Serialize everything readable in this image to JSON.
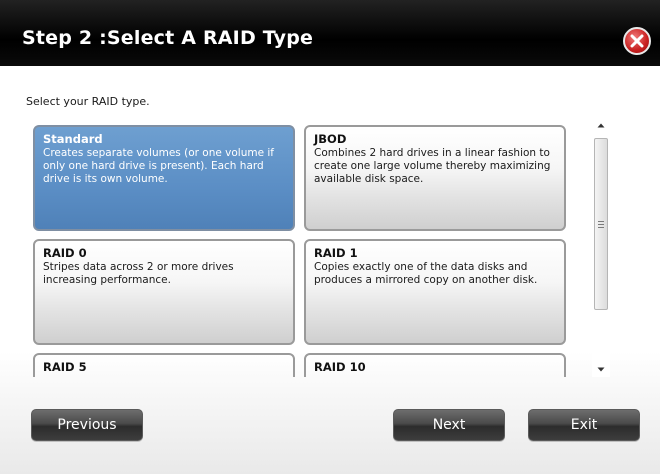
{
  "dialog": {
    "title": "Step 2 :Select A RAID Type",
    "instruction": "Select your RAID type."
  },
  "raid_options": [
    {
      "title": "Standard",
      "description": "Creates separate volumes (or one volume if only one hard drive is present). Each hard drive is its own volume.",
      "selected": true
    },
    {
      "title": "JBOD",
      "description": "Combines 2 hard drives in a linear fashion to create one large volume thereby maximizing available disk space.",
      "selected": false
    },
    {
      "title": "RAID 0",
      "description": "Stripes data across 2 or more drives increasing performance.",
      "selected": false
    },
    {
      "title": "RAID 1",
      "description": "Copies exactly one of the data disks and produces a mirrored copy on another disk.",
      "selected": false
    },
    {
      "title": "RAID 5",
      "description": "",
      "selected": false
    },
    {
      "title": "RAID 10",
      "description": "",
      "selected": false
    }
  ],
  "buttons": {
    "previous": "Previous",
    "next": "Next",
    "exit": "Exit"
  },
  "icons": {
    "close": "close-icon",
    "scroll_up": "arrow-up-icon",
    "scroll_down": "arrow-down-icon",
    "grip": "grip-icon"
  },
  "colors": {
    "selected_card": "#5b8ec5",
    "title_bar": "#000000",
    "close_button": "#c81f1f"
  }
}
